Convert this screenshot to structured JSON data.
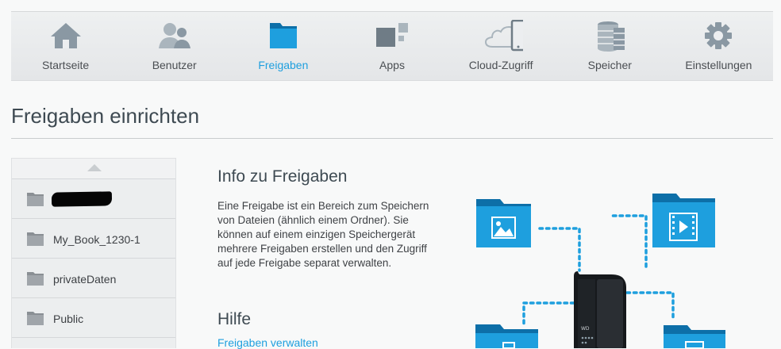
{
  "nav": {
    "items": [
      {
        "label": "Startseite",
        "icon": "home-icon"
      },
      {
        "label": "Benutzer",
        "icon": "users-icon"
      },
      {
        "label": "Freigaben",
        "icon": "folder-icon",
        "active": true
      },
      {
        "label": "Apps",
        "icon": "apps-icon"
      },
      {
        "label": "Cloud-Zugriff",
        "icon": "cloud-device-icon"
      },
      {
        "label": "Speicher",
        "icon": "storage-icon"
      },
      {
        "label": "Einstellungen",
        "icon": "gear-icon"
      }
    ],
    "active_color": "#1e9fde"
  },
  "page": {
    "title": "Freigaben einrichten"
  },
  "shares": {
    "items": [
      {
        "name": "",
        "redacted": true
      },
      {
        "name": "My_Book_1230-1"
      },
      {
        "name": "privateDaten"
      },
      {
        "name": "Public"
      }
    ]
  },
  "info": {
    "title": "Info zu Freigaben",
    "text": "Eine Freigabe ist ein Bereich zum Speichern von Dateien (ähnlich einem Ordner). Sie können auf einem einzigen Speichergerät mehrere Freigaben erstellen und den Zugriff auf jede Freigabe separat verwalten."
  },
  "help": {
    "title": "Hilfe",
    "link": "Freigaben verwalten"
  },
  "colors": {
    "accent": "#1e9fde",
    "folder": "#1e9fde",
    "folder_dark": "#0d6fa8"
  }
}
